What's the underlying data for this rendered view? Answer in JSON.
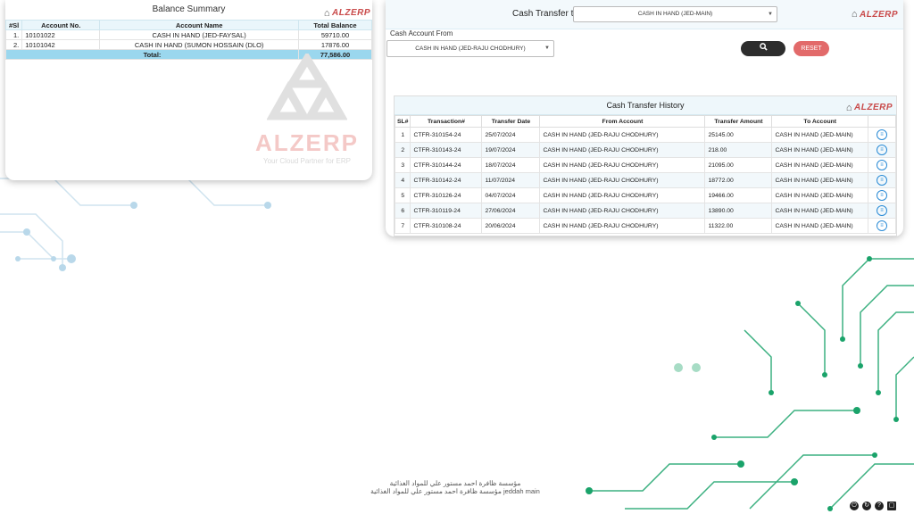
{
  "balance_summary": {
    "title": "Balance Summary",
    "brand": "ALZERP",
    "columns": [
      "#Sl",
      "Account No.",
      "Account Name",
      "Total Balance"
    ],
    "rows": [
      {
        "sl": "1.",
        "account_no": "10101022",
        "account_name": "CASH IN HAND (JED-FAYSAL)",
        "balance": "59710.00"
      },
      {
        "sl": "2.",
        "account_no": "10101042",
        "account_name": "CASH IN HAND (SUMON HOSSAIN (DLO)",
        "balance": "17876.00"
      }
    ],
    "total_label": "Total:",
    "total_value": "77,586.00"
  },
  "watermark": {
    "text": "ALZERP",
    "tagline": "Your Cloud Partner for ERP"
  },
  "transfer": {
    "to_label": "Cash Transfer to",
    "to_value": "CASH IN HAND (JED-MAIN)",
    "brand": "ALZERP",
    "from_label": "Cash Account From",
    "from_value": "CASH IN HAND (JED-RAJU CHODHURY)",
    "search_icon": "search-icon",
    "reset_label": "RESET"
  },
  "history": {
    "title": "Cash Transfer History",
    "brand": "ALZERP",
    "columns": [
      "SL#",
      "Transaction#",
      "Transfer Date",
      "From Account",
      "Transfer Amount",
      "To Account",
      ""
    ],
    "rows": [
      {
        "sl": "1",
        "txn": "CTFR-310154-24",
        "date": "25/07/2024",
        "from": "CASH IN HAND (JED-RAJU CHODHURY)",
        "amount": "25145.00",
        "to": "CASH IN HAND (JED-MAIN)"
      },
      {
        "sl": "2",
        "txn": "CTFR-310143-24",
        "date": "19/07/2024",
        "from": "CASH IN HAND (JED-RAJU CHODHURY)",
        "amount": "218.00",
        "to": "CASH IN HAND (JED-MAIN)"
      },
      {
        "sl": "3",
        "txn": "CTFR-310144-24",
        "date": "18/07/2024",
        "from": "CASH IN HAND (JED-RAJU CHODHURY)",
        "amount": "21095.00",
        "to": "CASH IN HAND (JED-MAIN)"
      },
      {
        "sl": "4",
        "txn": "CTFR-310142-24",
        "date": "11/07/2024",
        "from": "CASH IN HAND (JED-RAJU CHODHURY)",
        "amount": "18772.00",
        "to": "CASH IN HAND (JED-MAIN)"
      },
      {
        "sl": "5",
        "txn": "CTFR-310126-24",
        "date": "04/07/2024",
        "from": "CASH IN HAND (JED-RAJU CHODHURY)",
        "amount": "19466.00",
        "to": "CASH IN HAND (JED-MAIN)"
      },
      {
        "sl": "6",
        "txn": "CTFR-310119-24",
        "date": "27/06/2024",
        "from": "CASH IN HAND (JED-RAJU CHODHURY)",
        "amount": "13890.00",
        "to": "CASH IN HAND (JED-MAIN)"
      },
      {
        "sl": "7",
        "txn": "CTFR-310108-24",
        "date": "20/06/2024",
        "from": "CASH IN HAND (JED-RAJU CHODHURY)",
        "amount": "11322.00",
        "to": "CASH IN HAND (JED-MAIN)"
      }
    ]
  },
  "footer": {
    "line1": "مؤسسة ظافرة احمد مستور علي للمواد الغذائية",
    "line2": "مؤسسة ظافرة احمد مستور علي للمواد الغذائية jeddah main"
  },
  "colors": {
    "accent": "#9bd7ee",
    "reset": "#e26a6a",
    "search": "#2d2d2d",
    "circuit_green": "#1aa36a",
    "circuit_blue": "#a9cfe6"
  }
}
